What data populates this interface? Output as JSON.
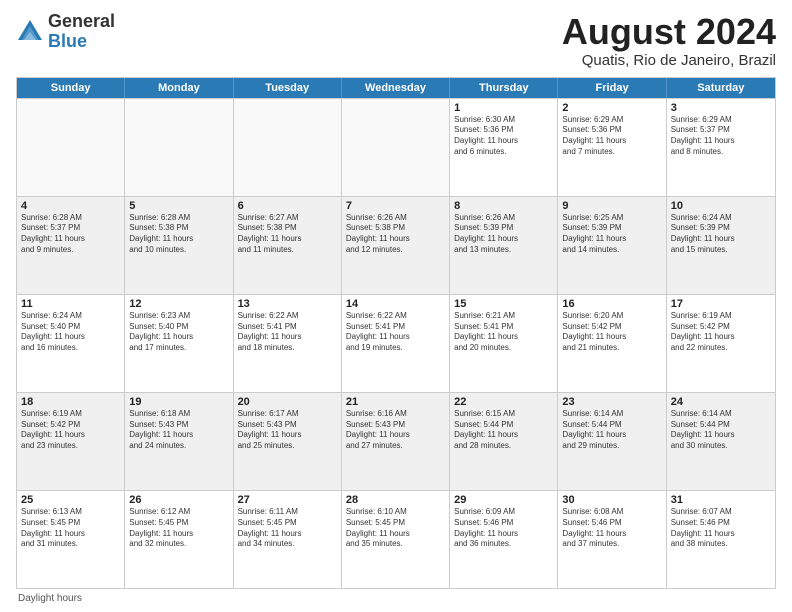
{
  "logo": {
    "general": "General",
    "blue": "Blue"
  },
  "title": "August 2024",
  "subtitle": "Quatis, Rio de Janeiro, Brazil",
  "header_days": [
    "Sunday",
    "Monday",
    "Tuesday",
    "Wednesday",
    "Thursday",
    "Friday",
    "Saturday"
  ],
  "footnote": "Daylight hours",
  "weeks": [
    [
      {
        "day": "",
        "info": "",
        "empty": true
      },
      {
        "day": "",
        "info": "",
        "empty": true
      },
      {
        "day": "",
        "info": "",
        "empty": true
      },
      {
        "day": "",
        "info": "",
        "empty": true
      },
      {
        "day": "1",
        "info": "Sunrise: 6:30 AM\nSunset: 5:36 PM\nDaylight: 11 hours\nand 6 minutes.",
        "shaded": false
      },
      {
        "day": "2",
        "info": "Sunrise: 6:29 AM\nSunset: 5:36 PM\nDaylight: 11 hours\nand 7 minutes.",
        "shaded": false
      },
      {
        "day": "3",
        "info": "Sunrise: 6:29 AM\nSunset: 5:37 PM\nDaylight: 11 hours\nand 8 minutes.",
        "shaded": false
      }
    ],
    [
      {
        "day": "4",
        "info": "Sunrise: 6:28 AM\nSunset: 5:37 PM\nDaylight: 11 hours\nand 9 minutes.",
        "shaded": true
      },
      {
        "day": "5",
        "info": "Sunrise: 6:28 AM\nSunset: 5:38 PM\nDaylight: 11 hours\nand 10 minutes.",
        "shaded": true
      },
      {
        "day": "6",
        "info": "Sunrise: 6:27 AM\nSunset: 5:38 PM\nDaylight: 11 hours\nand 11 minutes.",
        "shaded": true
      },
      {
        "day": "7",
        "info": "Sunrise: 6:26 AM\nSunset: 5:38 PM\nDaylight: 11 hours\nand 12 minutes.",
        "shaded": true
      },
      {
        "day": "8",
        "info": "Sunrise: 6:26 AM\nSunset: 5:39 PM\nDaylight: 11 hours\nand 13 minutes.",
        "shaded": true
      },
      {
        "day": "9",
        "info": "Sunrise: 6:25 AM\nSunset: 5:39 PM\nDaylight: 11 hours\nand 14 minutes.",
        "shaded": true
      },
      {
        "day": "10",
        "info": "Sunrise: 6:24 AM\nSunset: 5:39 PM\nDaylight: 11 hours\nand 15 minutes.",
        "shaded": true
      }
    ],
    [
      {
        "day": "11",
        "info": "Sunrise: 6:24 AM\nSunset: 5:40 PM\nDaylight: 11 hours\nand 16 minutes.",
        "shaded": false
      },
      {
        "day": "12",
        "info": "Sunrise: 6:23 AM\nSunset: 5:40 PM\nDaylight: 11 hours\nand 17 minutes.",
        "shaded": false
      },
      {
        "day": "13",
        "info": "Sunrise: 6:22 AM\nSunset: 5:41 PM\nDaylight: 11 hours\nand 18 minutes.",
        "shaded": false
      },
      {
        "day": "14",
        "info": "Sunrise: 6:22 AM\nSunset: 5:41 PM\nDaylight: 11 hours\nand 19 minutes.",
        "shaded": false
      },
      {
        "day": "15",
        "info": "Sunrise: 6:21 AM\nSunset: 5:41 PM\nDaylight: 11 hours\nand 20 minutes.",
        "shaded": false
      },
      {
        "day": "16",
        "info": "Sunrise: 6:20 AM\nSunset: 5:42 PM\nDaylight: 11 hours\nand 21 minutes.",
        "shaded": false
      },
      {
        "day": "17",
        "info": "Sunrise: 6:19 AM\nSunset: 5:42 PM\nDaylight: 11 hours\nand 22 minutes.",
        "shaded": false
      }
    ],
    [
      {
        "day": "18",
        "info": "Sunrise: 6:19 AM\nSunset: 5:42 PM\nDaylight: 11 hours\nand 23 minutes.",
        "shaded": true
      },
      {
        "day": "19",
        "info": "Sunrise: 6:18 AM\nSunset: 5:43 PM\nDaylight: 11 hours\nand 24 minutes.",
        "shaded": true
      },
      {
        "day": "20",
        "info": "Sunrise: 6:17 AM\nSunset: 5:43 PM\nDaylight: 11 hours\nand 25 minutes.",
        "shaded": true
      },
      {
        "day": "21",
        "info": "Sunrise: 6:16 AM\nSunset: 5:43 PM\nDaylight: 11 hours\nand 27 minutes.",
        "shaded": true
      },
      {
        "day": "22",
        "info": "Sunrise: 6:15 AM\nSunset: 5:44 PM\nDaylight: 11 hours\nand 28 minutes.",
        "shaded": true
      },
      {
        "day": "23",
        "info": "Sunrise: 6:14 AM\nSunset: 5:44 PM\nDaylight: 11 hours\nand 29 minutes.",
        "shaded": true
      },
      {
        "day": "24",
        "info": "Sunrise: 6:14 AM\nSunset: 5:44 PM\nDaylight: 11 hours\nand 30 minutes.",
        "shaded": true
      }
    ],
    [
      {
        "day": "25",
        "info": "Sunrise: 6:13 AM\nSunset: 5:45 PM\nDaylight: 11 hours\nand 31 minutes.",
        "shaded": false
      },
      {
        "day": "26",
        "info": "Sunrise: 6:12 AM\nSunset: 5:45 PM\nDaylight: 11 hours\nand 32 minutes.",
        "shaded": false
      },
      {
        "day": "27",
        "info": "Sunrise: 6:11 AM\nSunset: 5:45 PM\nDaylight: 11 hours\nand 34 minutes.",
        "shaded": false
      },
      {
        "day": "28",
        "info": "Sunrise: 6:10 AM\nSunset: 5:45 PM\nDaylight: 11 hours\nand 35 minutes.",
        "shaded": false
      },
      {
        "day": "29",
        "info": "Sunrise: 6:09 AM\nSunset: 5:46 PM\nDaylight: 11 hours\nand 36 minutes.",
        "shaded": false
      },
      {
        "day": "30",
        "info": "Sunrise: 6:08 AM\nSunset: 5:46 PM\nDaylight: 11 hours\nand 37 minutes.",
        "shaded": false
      },
      {
        "day": "31",
        "info": "Sunrise: 6:07 AM\nSunset: 5:46 PM\nDaylight: 11 hours\nand 38 minutes.",
        "shaded": false
      }
    ]
  ]
}
